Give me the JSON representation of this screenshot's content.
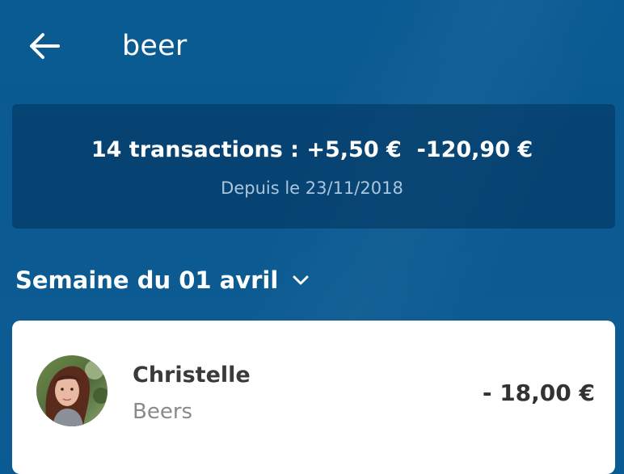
{
  "header": {
    "back_icon": "arrow-left-icon",
    "title": "beer"
  },
  "summary": {
    "count_label": "14 transactions : +5,50 €  -120,90 €",
    "since_label": "Depuis le 23/11/2018"
  },
  "week": {
    "label": "Semaine du 01 avril",
    "icon": "chevron-down-icon"
  },
  "transactions": [
    {
      "name": "Christelle",
      "category": "Beers",
      "amount": "- 18,00 €",
      "avatar_icon": "user-avatar"
    }
  ],
  "colors": {
    "background": "#0b5a91",
    "summary_card": "#0a4574",
    "summary_subtext": "#a9c6de",
    "card": "#ffffff",
    "name_text": "#3a3a3a",
    "category_text": "#8a8a8a"
  }
}
